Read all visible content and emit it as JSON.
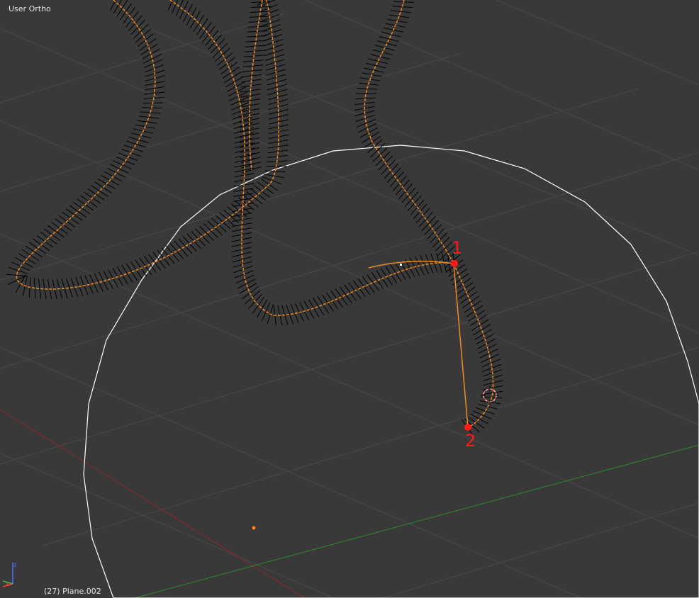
{
  "view": {
    "projection_label": "User Ortho",
    "object_label": "(27) Plane.002"
  },
  "annotations": {
    "point_1_label": "1",
    "point_2_label": "2"
  },
  "colors": {
    "background": "#393939",
    "grid": "#4a4a4a",
    "curve_selected": "#f08a24",
    "normals": "#000000",
    "circle": "#ffffff",
    "annotation": "#ff1a1a",
    "x_axis": "#8b2a2a",
    "y_axis": "#2f8a2f"
  },
  "gizmo": {
    "axis_z": "z",
    "axis_x": "x"
  }
}
